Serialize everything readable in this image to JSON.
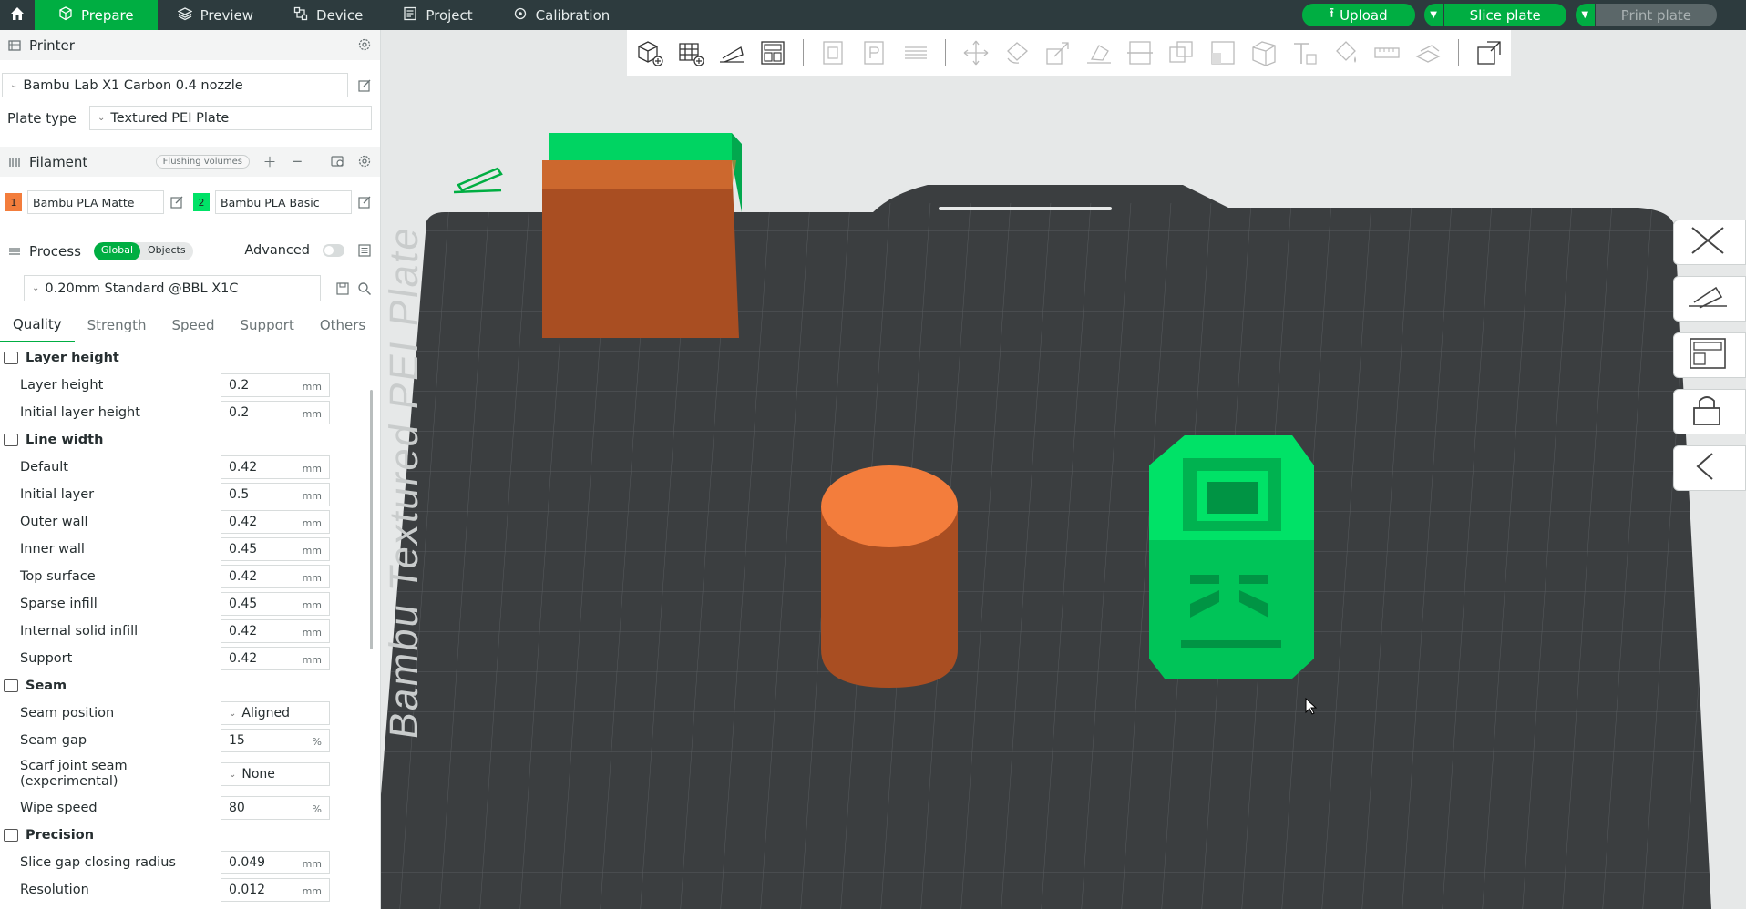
{
  "topbar": {
    "tabs": [
      {
        "label": "Prepare",
        "icon": "cube-icon",
        "active": true
      },
      {
        "label": "Preview",
        "icon": "layers-icon",
        "active": false
      },
      {
        "label": "Device",
        "icon": "device-icon",
        "active": false
      },
      {
        "label": "Project",
        "icon": "project-icon",
        "active": false
      },
      {
        "label": "Calibration",
        "icon": "calibration-icon",
        "active": false
      }
    ],
    "upload_label": "Upload",
    "slice_label": "Slice plate",
    "print_label": "Print plate",
    "accent_color": "#00ae42"
  },
  "printer": {
    "section_title": "Printer",
    "printer_name": "Bambu Lab X1 Carbon 0.4 nozzle",
    "plate_type_label": "Plate type",
    "plate_type_value": "Textured PEI Plate"
  },
  "filament": {
    "section_title": "Filament",
    "flushing_label": "Flushing volumes",
    "items": [
      {
        "num": "1",
        "name": "Bambu PLA Matte",
        "color": "#f37d3c"
      },
      {
        "num": "2",
        "name": "Bambu PLA Basic",
        "color": "#00e267"
      }
    ]
  },
  "process": {
    "section_title": "Process",
    "global_label": "Global",
    "objects_label": "Objects",
    "advanced_label": "Advanced",
    "preset": "0.20mm Standard @BBL X1C",
    "tabs": [
      "Quality",
      "Strength",
      "Speed",
      "Support",
      "Others"
    ]
  },
  "groups": {
    "layer_height": {
      "title": "Layer height",
      "params": [
        {
          "label": "Layer height",
          "value": "0.2",
          "unit": "mm"
        },
        {
          "label": "Initial layer height",
          "value": "0.2",
          "unit": "mm"
        }
      ]
    },
    "line_width": {
      "title": "Line width",
      "params": [
        {
          "label": "Default",
          "value": "0.42",
          "unit": "mm"
        },
        {
          "label": "Initial layer",
          "value": "0.5",
          "unit": "mm"
        },
        {
          "label": "Outer wall",
          "value": "0.42",
          "unit": "mm"
        },
        {
          "label": "Inner wall",
          "value": "0.45",
          "unit": "mm"
        },
        {
          "label": "Top surface",
          "value": "0.42",
          "unit": "mm"
        },
        {
          "label": "Sparse infill",
          "value": "0.45",
          "unit": "mm"
        },
        {
          "label": "Internal solid infill",
          "value": "0.42",
          "unit": "mm"
        },
        {
          "label": "Support",
          "value": "0.42",
          "unit": "mm"
        }
      ]
    },
    "seam": {
      "title": "Seam",
      "seam_position_label": "Seam position",
      "seam_position_value": "Aligned",
      "seam_gap_label": "Seam gap",
      "seam_gap_value": "15",
      "seam_gap_unit": "%",
      "scarf_label_1": "Scarf joint seam",
      "scarf_label_2": "(experimental)",
      "scarf_value": "None",
      "wipe_label": "Wipe speed",
      "wipe_value": "80",
      "wipe_unit": "%"
    },
    "precision": {
      "title": "Precision",
      "params": [
        {
          "label": "Slice gap closing radius",
          "value": "0.049",
          "unit": "mm"
        },
        {
          "label": "Resolution",
          "value": "0.012",
          "unit": "mm"
        }
      ]
    }
  },
  "viewport": {
    "plate_label": "Bambu Textured PEI Plate",
    "object_colors": {
      "orange": "#f37d3c",
      "green": "#00e267",
      "bed": "#3b3e40"
    }
  }
}
